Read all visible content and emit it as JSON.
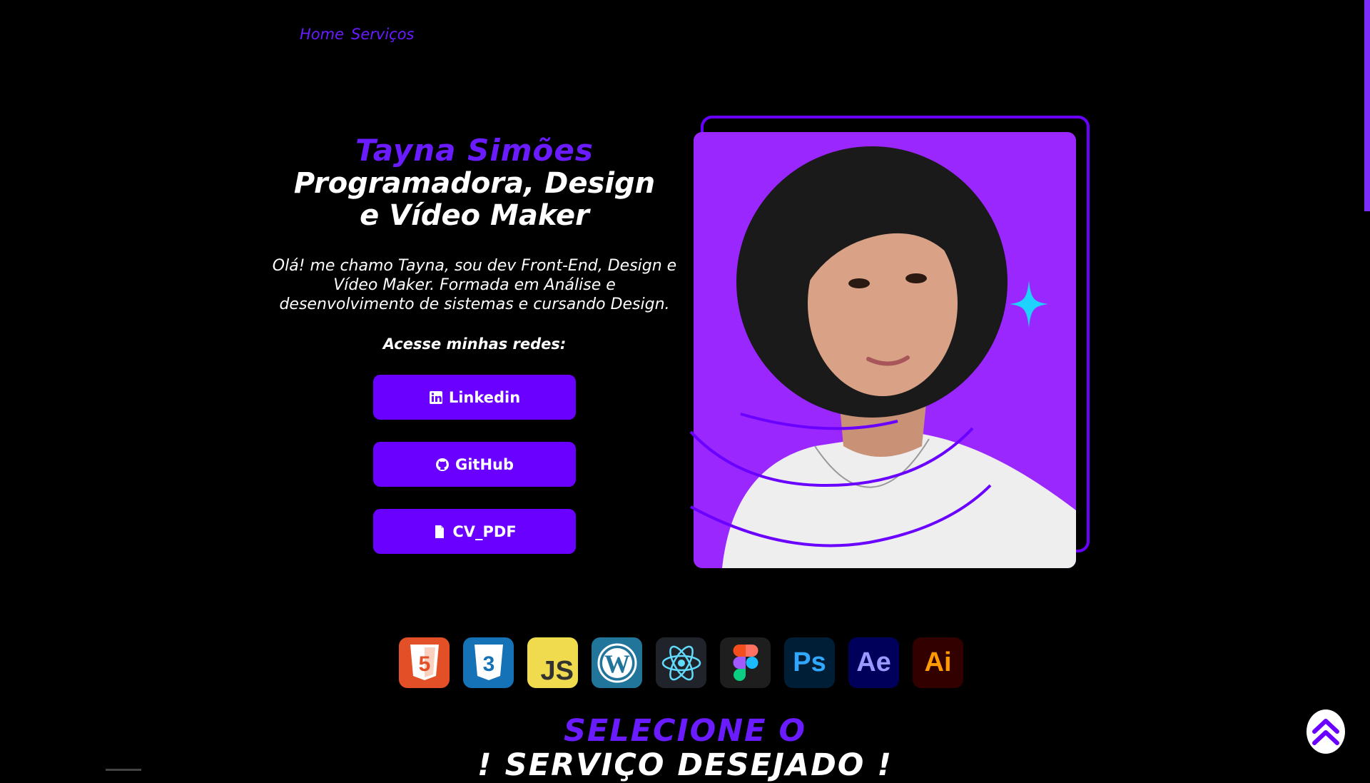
{
  "nav": {
    "items": [
      "Home",
      "Serviços"
    ]
  },
  "hero": {
    "name": "Tayna Simões",
    "role_line1": "Programadora, Design",
    "role_line2": "e Vídeo Maker",
    "intro": "Olá! me chamo Tayna, sou dev Front-End, Design e Vídeo Maker. Formada em Análise e desenvolvimento de sistemas e cursando Design.",
    "social_title": "Acesse minhas redes:",
    "buttons": [
      {
        "label": "Linkedin",
        "icon": "linkedin-icon"
      },
      {
        "label": "GitHub",
        "icon": "github-icon"
      },
      {
        "label": "CV_PDF",
        "icon": "document-icon"
      }
    ]
  },
  "skills": [
    {
      "name": "html5-icon",
      "label": "5",
      "bg": "#e34f26"
    },
    {
      "name": "css3-icon",
      "label": "3",
      "bg": "#1572b6"
    },
    {
      "name": "javascript-icon",
      "label": "JS",
      "bg": "#f0db4f"
    },
    {
      "name": "wordpress-icon",
      "label": "W",
      "bg": "#21759b"
    },
    {
      "name": "react-icon",
      "label": "",
      "bg": "#20232a"
    },
    {
      "name": "figma-icon",
      "label": "",
      "bg": "#1e1e1e"
    },
    {
      "name": "photoshop-icon",
      "label": "Ps",
      "bg": "#001e36"
    },
    {
      "name": "after-effects-icon",
      "label": "Ae",
      "bg": "#00005b"
    },
    {
      "name": "illustrator-icon",
      "label": "Ai",
      "bg": "#330000"
    }
  ],
  "services": {
    "line1": "SELECIONE O",
    "line2": "! SERVIÇO DESEJADO !"
  },
  "colors": {
    "accent": "#6a00ff",
    "photo_bg": "#9b27ff",
    "sparkle": "#1fd1ff"
  }
}
